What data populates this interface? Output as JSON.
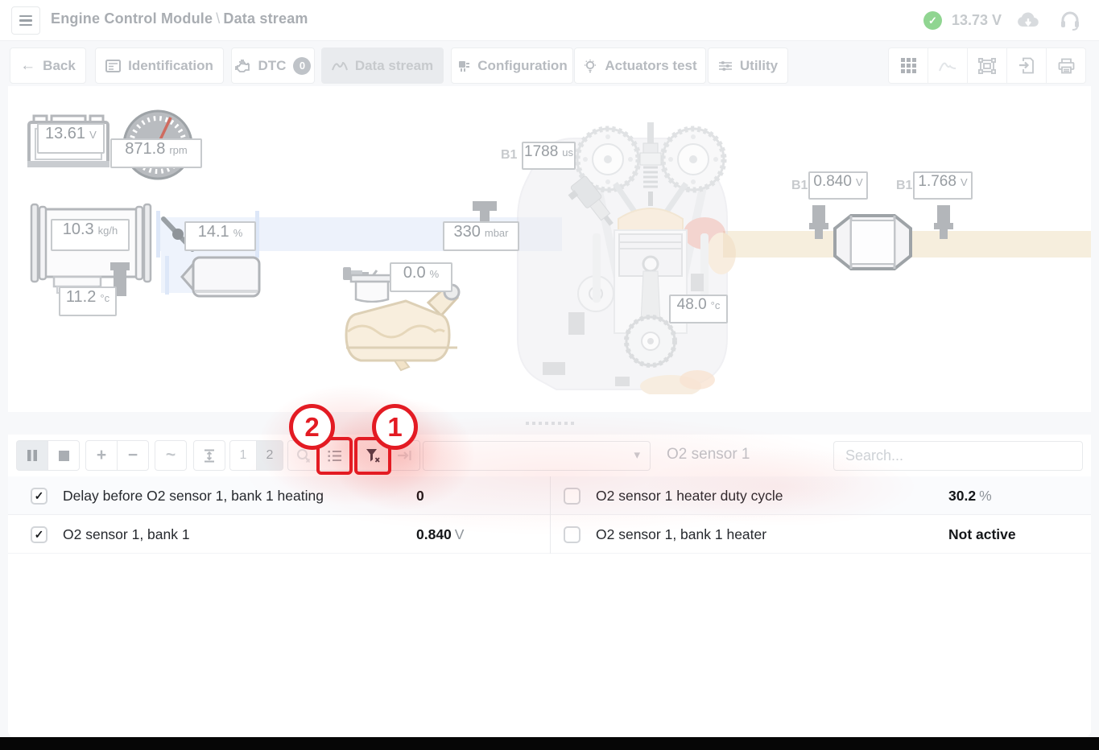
{
  "header": {
    "title_module": "Engine Control Module",
    "title_sep": "\\",
    "title_page": "Data stream",
    "battery_status_voltage": "13.73 V"
  },
  "glyphs": {
    "check": "✓",
    "chevron_down": "▾",
    "back_arrow": "←",
    "plus": "+",
    "minus": "−",
    "wave": "~"
  },
  "tabs": {
    "back": "Back",
    "identification": "Identification",
    "dtc": "DTC",
    "dtc_count": "0",
    "data_stream": "Data stream",
    "configuration": "Configuration",
    "actuators_test": "Actuators test",
    "utility": "Utility"
  },
  "diagram": {
    "battery": {
      "value": "13.61",
      "unit": "V"
    },
    "rpm": {
      "value": "871.8",
      "unit": "rpm"
    },
    "air_flow": {
      "value": "10.3",
      "unit": "kg/h"
    },
    "intake_temp": {
      "value": "11.2",
      "unit": "°c"
    },
    "throttle": {
      "value": "14.1",
      "unit": "%"
    },
    "manifold_pressure": {
      "value": "330",
      "unit": "mbar"
    },
    "purge_valve": {
      "value": "0.0",
      "unit": "%"
    },
    "injection": {
      "bank": "B1",
      "value": "1788",
      "unit": "us"
    },
    "coolant_temp": {
      "value": "48.0",
      "unit": "°c"
    },
    "o2_upstream": {
      "bank": "B1",
      "value": "0.840",
      "unit": "V"
    },
    "o2_downstream": {
      "bank": "B1",
      "value": "1.768",
      "unit": "V"
    }
  },
  "toolbar": {
    "page1": "1",
    "page2": "2",
    "dropdown_value": "",
    "selected_param": "O2 sensor 1",
    "search_placeholder": "Search..."
  },
  "annotations": {
    "step1": "1",
    "step2": "2"
  },
  "table": {
    "rows": [
      {
        "left": {
          "check": "✓",
          "label": "Delay before O2 sensor 1, bank 1 heating",
          "value": "0",
          "unit": ""
        },
        "right": {
          "check": "",
          "label": "O2 sensor 1 heater duty cycle",
          "value": "30.2",
          "unit": "%"
        }
      },
      {
        "left": {
          "check": "✓",
          "label": "O2 sensor 1, bank 1",
          "value": "0.840",
          "unit": "V"
        },
        "right": {
          "check": "",
          "label": "O2 sensor 1, bank 1 heater",
          "value": "Not active",
          "unit": ""
        }
      }
    ]
  },
  "colors": {
    "accent_red": "#e31b23",
    "status_green": "#90d591",
    "filter_icon_active": "#2c3848",
    "intake_band": "#edf2fb",
    "exhaust_band": "#f6eedd"
  }
}
